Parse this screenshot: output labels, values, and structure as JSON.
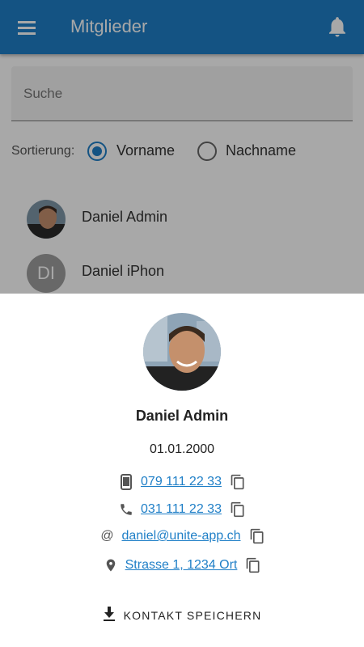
{
  "app_bar": {
    "title": "Mitglieder",
    "menu_icon": "menu-icon",
    "notification_icon": "bell-icon",
    "color": "#1f7fc7"
  },
  "search": {
    "placeholder": "Suche",
    "value": ""
  },
  "sort": {
    "label": "Sortierung:",
    "options": [
      {
        "label": "Vorname",
        "selected": true
      },
      {
        "label": "Nachname",
        "selected": false
      }
    ]
  },
  "members": [
    {
      "name": "Daniel Admin",
      "initials": ""
    },
    {
      "name": "Daniel iPhon",
      "initials": "DI"
    }
  ],
  "contact_sheet": {
    "name": "Daniel Admin",
    "birthday": "01.01.2000",
    "mobile": "079 111 22 33",
    "phone": "031 111 22 33",
    "email": "daniel@unite-app.ch",
    "address": "Strasse 1, 1234 Ort",
    "save_label": "KONTAKT SPEICHERN"
  }
}
